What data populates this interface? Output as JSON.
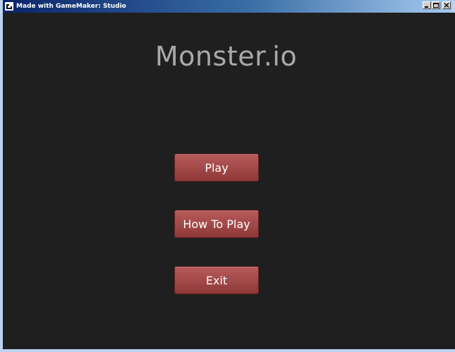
{
  "window": {
    "title": "Made with GameMaker: Studio",
    "icon": "gamemaker-icon",
    "controls": [
      "minimize-icon",
      "maximize-icon",
      "close-icon"
    ]
  },
  "game": {
    "title": "Monster.io",
    "menu": {
      "play_label": "Play",
      "how_to_play_label": "How To Play",
      "exit_label": "Exit"
    }
  },
  "colors": {
    "background": "#1f1f1f",
    "title_text": "#a9a9a9",
    "button_fill": "#a54b4b",
    "button_text": "#ffffff",
    "titlebar": "#0a246a"
  }
}
